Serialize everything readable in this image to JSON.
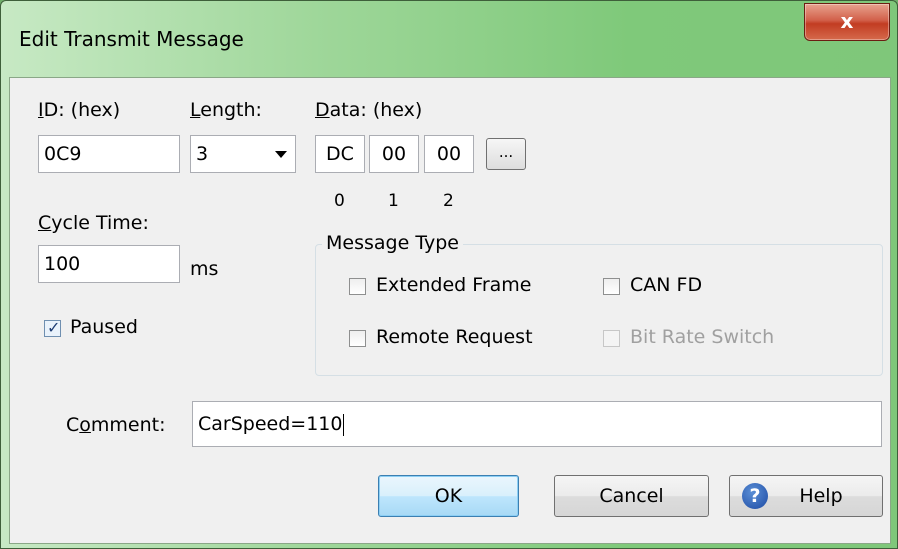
{
  "window": {
    "title": "Edit Transmit Message",
    "close_glyph": "x"
  },
  "id_field": {
    "label_accel": "I",
    "label_rest": "D: (hex)",
    "value": "0C9"
  },
  "length_field": {
    "label_accel": "L",
    "label_rest": "ength:",
    "value": "3"
  },
  "data_field": {
    "label_accel": "D",
    "label_rest": "ata: (hex)",
    "bytes": [
      "DC",
      "00",
      "00"
    ],
    "indices": [
      "0",
      "1",
      "2"
    ],
    "more_label": "..."
  },
  "cycle": {
    "label_accel": "C",
    "label_rest": "ycle Time:",
    "value": "100",
    "unit": "ms"
  },
  "paused": {
    "label": "Paused",
    "checked": true
  },
  "message_type": {
    "title": "Message Type",
    "extended_frame": {
      "label": "Extended Frame",
      "checked": false
    },
    "can_fd": {
      "label": "CAN FD",
      "checked": false
    },
    "remote_request": {
      "label": "Remote Request",
      "checked": false
    },
    "bit_rate_switch": {
      "label": "Bit Rate Switch",
      "checked": false,
      "enabled": false
    }
  },
  "comment": {
    "label_pre": "C",
    "label_accel": "o",
    "label_rest": "mment:",
    "value": "CarSpeed=110"
  },
  "buttons": {
    "ok": "OK",
    "cancel": "Cancel",
    "help": "Help",
    "help_icon": "?"
  },
  "colors": {
    "titlebar_green": "#7fc97a",
    "close_red": "#c23c22",
    "dialog_bg": "#f0f0f0"
  }
}
